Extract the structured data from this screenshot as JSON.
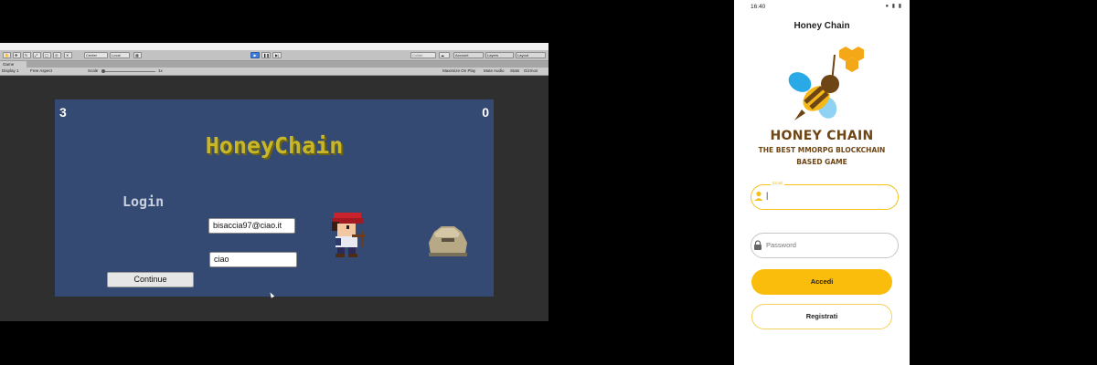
{
  "unity": {
    "menu": [
      "File",
      "Edit",
      "Assets",
      "GameObject",
      "Component",
      "Cinemachine",
      "Mobile Input",
      "Window",
      "Help"
    ],
    "toolbar": {
      "pivot": "Center",
      "space": "Local",
      "collab": "Collab",
      "account": "Account",
      "layers": "Layers",
      "layout": "Layout"
    },
    "tab": "Game",
    "gamebar": {
      "display": "Display 1",
      "aspect": "Free Aspect",
      "scale_label": "Scale",
      "scale_value": "1x",
      "maximize": "Maximize On Play",
      "mute": "Mute Audio",
      "stats": "Stats",
      "gizmos": "Gizmos"
    },
    "game": {
      "score_left": "3",
      "score_right": "0",
      "title": "HoneyChain",
      "login_heading": "Login",
      "email_value": "bisaccia97@ciao.it",
      "password_value": "ciao",
      "continue_label": "Continue"
    }
  },
  "phone": {
    "status_time": "16:40",
    "status_icons": "● ▮ ▮",
    "app_title": "Honey Chain",
    "brand_name": "HONEY CHAIN",
    "tagline_line1": "THE BEST MMORPG BLOCKCHAIN",
    "tagline_line2": "BASED GAME",
    "email_label": "Email",
    "email_value": "|",
    "password_placeholder": "Password",
    "login_button": "Accedi",
    "register_button": "Registrati",
    "colors": {
      "accent": "#fbbd0b",
      "brand_text": "#6e4514"
    }
  }
}
